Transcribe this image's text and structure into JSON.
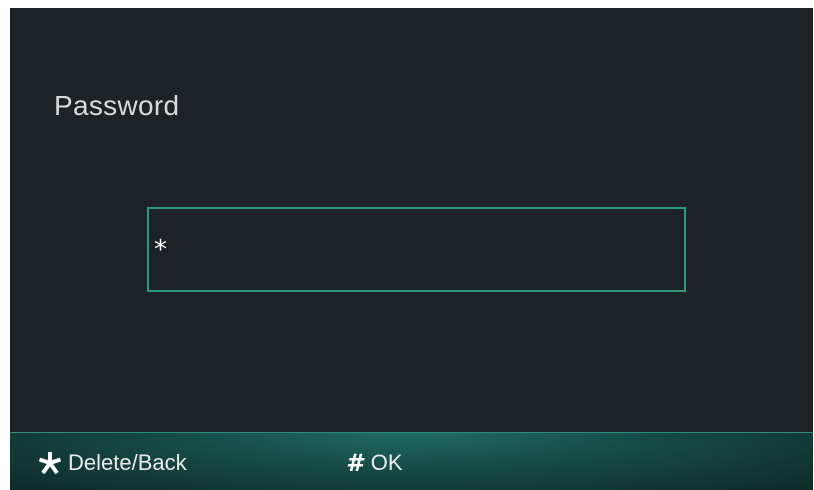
{
  "screen": {
    "title": "Password",
    "password_field": {
      "value": "*"
    }
  },
  "footer": {
    "delete": {
      "icon": "asterisk-icon",
      "label": "Delete/Back"
    },
    "ok": {
      "icon": "hash-icon",
      "label": "OK"
    }
  },
  "colors": {
    "background": "#1d2227",
    "accent": "#2a9a85",
    "footer": "#164a45",
    "text": "#d8dadb"
  }
}
